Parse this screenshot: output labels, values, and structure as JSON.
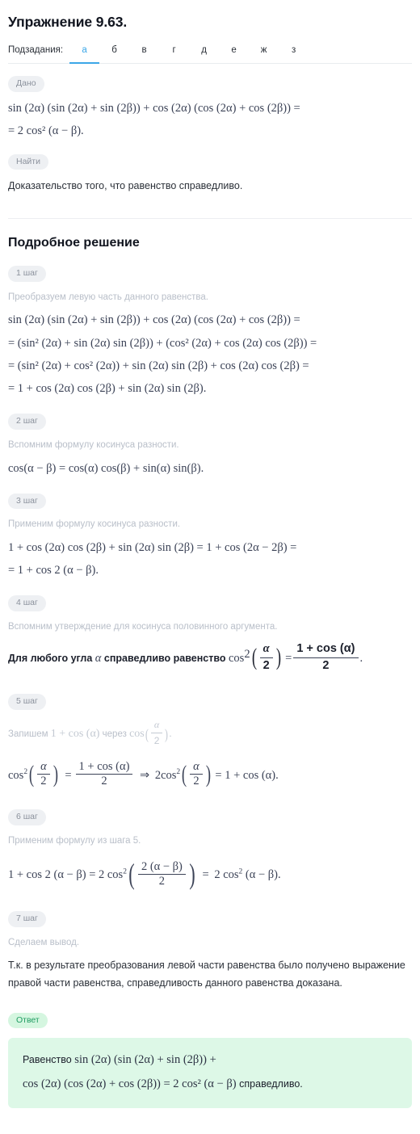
{
  "header": {
    "title": "Упражнение 9.63.",
    "subtasks_label": "Подзадания:",
    "tabs": [
      {
        "label": "а",
        "active": true
      },
      {
        "label": "б",
        "active": false
      },
      {
        "label": "в",
        "active": false
      },
      {
        "label": "г",
        "active": false
      },
      {
        "label": "д",
        "active": false
      },
      {
        "label": "е",
        "active": false
      },
      {
        "label": "ж",
        "active": false
      },
      {
        "label": "з",
        "active": false
      }
    ]
  },
  "given": {
    "badge": "Дано",
    "line1": "sin (2α) (sin (2α) + sin (2β)) + cos (2α) (cos (2α) + cos (2β)) =",
    "line2": "= 2 cos² (α − β)."
  },
  "find": {
    "badge": "Найти",
    "text": "Доказательство того, что равенство справедливо."
  },
  "solution": {
    "title": "Подробное решение",
    "steps": [
      {
        "badge": "1 шаг",
        "caption": "Преобразуем левую часть данного равенства.",
        "lines": [
          "sin (2α) (sin (2α) + sin (2β)) + cos (2α) (cos (2α) + cos (2β)) =",
          "= (sin² (2α) + sin (2α) sin (2β)) + (cos² (2α) + cos (2α) cos (2β)) =",
          "= (sin² (2α) + cos² (2α)) + sin (2α) sin (2β) + cos (2α) cos (2β) =",
          "= 1 + cos (2α) cos (2β) + sin (2α) sin (2β)."
        ]
      },
      {
        "badge": "2 шаг",
        "caption": "Вспомним формулу косинуса разности.",
        "lines": [
          "cos(α − β) = cos(α) cos(β) + sin(α) sin(β)."
        ]
      },
      {
        "badge": "3 шаг",
        "caption": "Применим формулу косинуса разности.",
        "lines": [
          "1 + cos (2α) cos (2β) + sin (2α) sin (2β) = 1 + cos (2α − 2β) =",
          "= 1 + cos 2 (α − β)."
        ]
      },
      {
        "badge": "4 шаг",
        "caption": "Вспомним утверждение для косинуса половинного аргумента.",
        "statement_prefix": "Для любого угла",
        "statement_alpha": "α",
        "statement_mid": "справедливо равенство",
        "statement_cos": "cos",
        "statement_pow": "2",
        "frac_num": "1 + cos (α)",
        "frac_den": "2",
        "half_num": "α",
        "half_den": "2",
        "statement_end": "."
      },
      {
        "badge": "5 шаг",
        "caption_prefix": "Запишем",
        "caption_math1": "1 + cos (α)",
        "caption_mid": "через",
        "caption_math2": "cos",
        "caption_end": ".",
        "eq_cos": "cos",
        "eq_pow": "2",
        "eq_half_num": "α",
        "eq_half_den": "2",
        "eq_equals": "=",
        "eq_frac_num": "1 + cos (α)",
        "eq_frac_den": "2",
        "eq_arrow": "⇒",
        "eq_two": "2",
        "eq_tail": "= 1 + cos (α)."
      },
      {
        "badge": "6 шаг",
        "caption": "Применим формулу из шага 5.",
        "eq_lead": "1 + cos 2 (α − β) = 2 cos",
        "eq_pow": "2",
        "eq_frac_num": "2 (α − β)",
        "eq_frac_den": "2",
        "eq_tail_equals": "=",
        "eq_tail": "2 cos",
        "eq_tail_pow": "2",
        "eq_tail_end": "(α − β)."
      },
      {
        "badge": "7 шаг",
        "caption": "Сделаем вывод.",
        "conclusion": "Т.к. в результате преобразования левой части равенства было получено выражение правой части равенства, справедливость данного равенства доказана."
      }
    ]
  },
  "answer": {
    "badge": "Ответ",
    "line1_ru": "Равенство",
    "line1_math": "sin (2α) (sin (2α) + sin (2β)) +",
    "line2_math": "cos (2α) (cos (2α) + cos (2β)) = 2 cos² (α − β)",
    "line2_ru": "справедливо."
  }
}
